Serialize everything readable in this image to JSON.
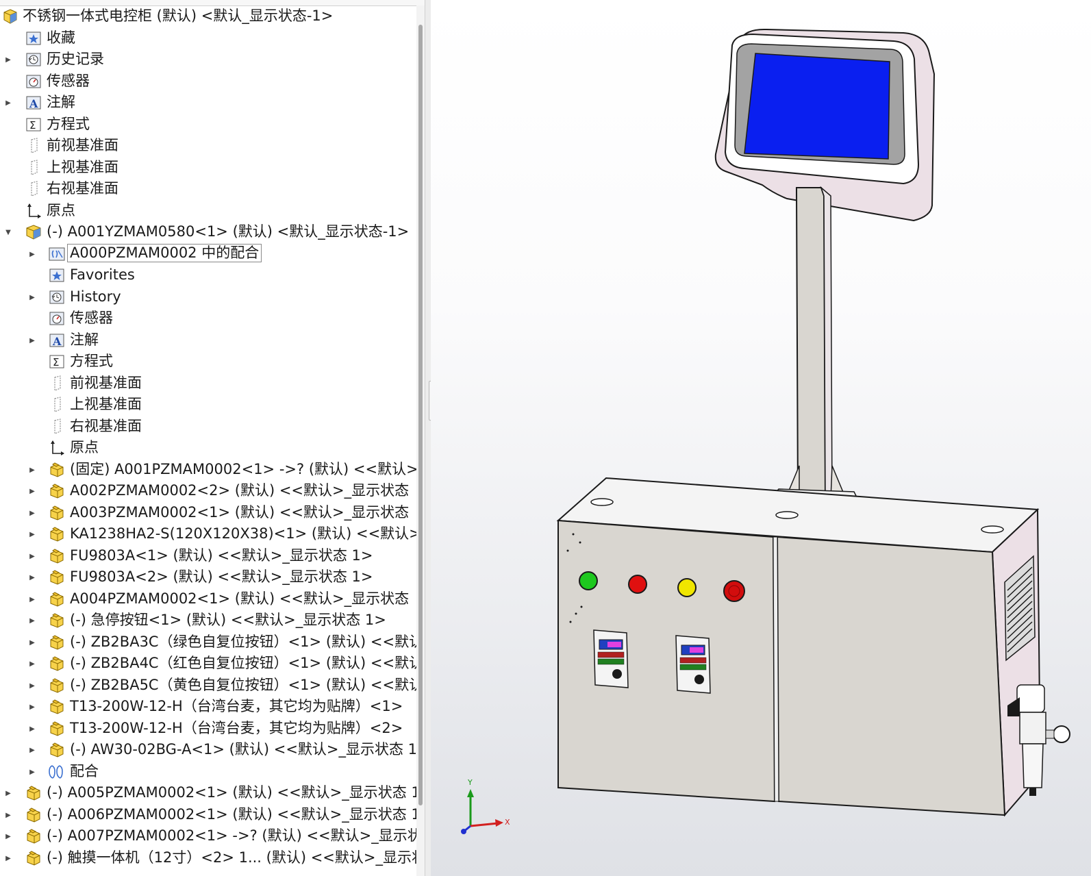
{
  "feature_tree": {
    "root": {
      "label": "不锈钢一体式电控柜 (默认) <默认_显示状态-1>",
      "icon": "assembly-icon"
    },
    "items": [
      {
        "label": "收藏",
        "icon": "favorites-icon",
        "expander": "none",
        "level": 1
      },
      {
        "label": "历史记录",
        "icon": "history-icon",
        "expander": "collapsed",
        "level": 1
      },
      {
        "label": "传感器",
        "icon": "sensors-icon",
        "expander": "none",
        "level": 1
      },
      {
        "label": "注解",
        "icon": "annotations-icon",
        "expander": "collapsed",
        "level": 1
      },
      {
        "label": "方程式",
        "icon": "equations-icon",
        "expander": "none",
        "level": 1
      },
      {
        "label": "前视基准面",
        "icon": "plane-icon",
        "expander": "none",
        "level": 1
      },
      {
        "label": "上视基准面",
        "icon": "plane-icon",
        "expander": "none",
        "level": 1
      },
      {
        "label": "右视基准面",
        "icon": "plane-icon",
        "expander": "none",
        "level": 1
      },
      {
        "label": "原点",
        "icon": "origin-icon",
        "expander": "none",
        "level": 1
      },
      {
        "label": "(-) A001YZMAM0580<1> (默认) <默认_显示状态-1>",
        "icon": "subassembly-icon",
        "expander": "expanded",
        "level": 1
      },
      {
        "label": "A000PZMAM0002 中的配合",
        "icon": "mates-folder-icon",
        "expander": "collapsed",
        "level": 2,
        "boxed": true
      },
      {
        "label": "Favorites",
        "icon": "favorites-icon",
        "expander": "none",
        "level": 2
      },
      {
        "label": "History",
        "icon": "history-icon",
        "expander": "collapsed",
        "level": 2
      },
      {
        "label": "传感器",
        "icon": "sensors-icon",
        "expander": "none",
        "level": 2
      },
      {
        "label": "注解",
        "icon": "annotations-icon",
        "expander": "collapsed",
        "level": 2
      },
      {
        "label": "方程式",
        "icon": "equations-icon",
        "expander": "none",
        "level": 2
      },
      {
        "label": "前视基准面",
        "icon": "plane-icon",
        "expander": "none",
        "level": 2
      },
      {
        "label": "上视基准面",
        "icon": "plane-icon",
        "expander": "none",
        "level": 2
      },
      {
        "label": "右视基准面",
        "icon": "plane-icon",
        "expander": "none",
        "level": 2
      },
      {
        "label": "原点",
        "icon": "origin-icon",
        "expander": "none",
        "level": 2
      },
      {
        "label": "(固定) A001PZMAM0002<1> ->? (默认) <<默认>",
        "icon": "part-icon",
        "expander": "collapsed",
        "level": 2
      },
      {
        "label": "A002PZMAM0002<2> (默认) <<默认>_显示状态",
        "icon": "part-icon",
        "expander": "collapsed",
        "level": 2
      },
      {
        "label": "A003PZMAM0002<1> (默认) <<默认>_显示状态",
        "icon": "part-icon",
        "expander": "collapsed",
        "level": 2
      },
      {
        "label": "KA1238HA2-S(120X120X38)<1> (默认) <<默认>_",
        "icon": "part-icon",
        "expander": "collapsed",
        "level": 2
      },
      {
        "label": "FU9803A<1> (默认) <<默认>_显示状态 1>",
        "icon": "part-icon",
        "expander": "collapsed",
        "level": 2
      },
      {
        "label": "FU9803A<2> (默认) <<默认>_显示状态 1>",
        "icon": "part-icon",
        "expander": "collapsed",
        "level": 2
      },
      {
        "label": "A004PZMAM0002<1> (默认) <<默认>_显示状态",
        "icon": "part-icon",
        "expander": "collapsed",
        "level": 2
      },
      {
        "label": "(-) 急停按钮<1> (默认) <<默认>_显示状态 1>",
        "icon": "part-icon",
        "expander": "collapsed",
        "level": 2
      },
      {
        "label": "(-) ZB2BA3C（绿色自复位按钮）<1> (默认) <<默认",
        "icon": "part-icon",
        "expander": "collapsed",
        "level": 2
      },
      {
        "label": "(-) ZB2BA4C（红色自复位按钮）<1> (默认) <<默认",
        "icon": "part-icon",
        "expander": "collapsed",
        "level": 2
      },
      {
        "label": "(-) ZB2BA5C（黄色自复位按钮）<1> (默认) <<默认",
        "icon": "part-icon",
        "expander": "collapsed",
        "level": 2
      },
      {
        "label": "T13-200W-12-H（台湾台麦，其它均为贴牌）<1>",
        "icon": "part-icon",
        "expander": "collapsed",
        "level": 2
      },
      {
        "label": "T13-200W-12-H（台湾台麦，其它均为贴牌）<2>",
        "icon": "part-icon",
        "expander": "collapsed",
        "level": 2
      },
      {
        "label": "(-) AW30-02BG-A<1> (默认) <<默认>_显示状态 1",
        "icon": "part-icon",
        "expander": "collapsed",
        "level": 2
      },
      {
        "label": "配合",
        "icon": "mates-icon",
        "expander": "collapsed",
        "level": 2
      },
      {
        "label": "(-) A005PZMAM0002<1> (默认) <<默认>_显示状态 1",
        "icon": "part-icon",
        "expander": "collapsed",
        "level": 1
      },
      {
        "label": "(-) A006PZMAM0002<1> (默认) <<默认>_显示状态 1",
        "icon": "part-icon",
        "expander": "collapsed",
        "level": 1
      },
      {
        "label": "(-) A007PZMAM0002<1> ->? (默认) <<默认>_显示状",
        "icon": "part-icon",
        "expander": "collapsed",
        "level": 1
      },
      {
        "label": "(-) 触摸一体机（12寸）<2> 1... (默认) <<默认>_显示状",
        "icon": "part-icon",
        "expander": "collapsed",
        "level": 1
      }
    ]
  },
  "viewport": {
    "triad": {
      "x_label": "X",
      "y_label": "Y"
    },
    "colors": {
      "cabinet_body": "#d9d6d0",
      "cabinet_side": "#ece0e6",
      "screen": "#0a1ff0",
      "screen_bezel": "#a3a3a3",
      "green_button": "#1ec81e",
      "red_button": "#e01010",
      "yellow_button": "#f0e600",
      "estop_button": "#d20d0d"
    }
  }
}
